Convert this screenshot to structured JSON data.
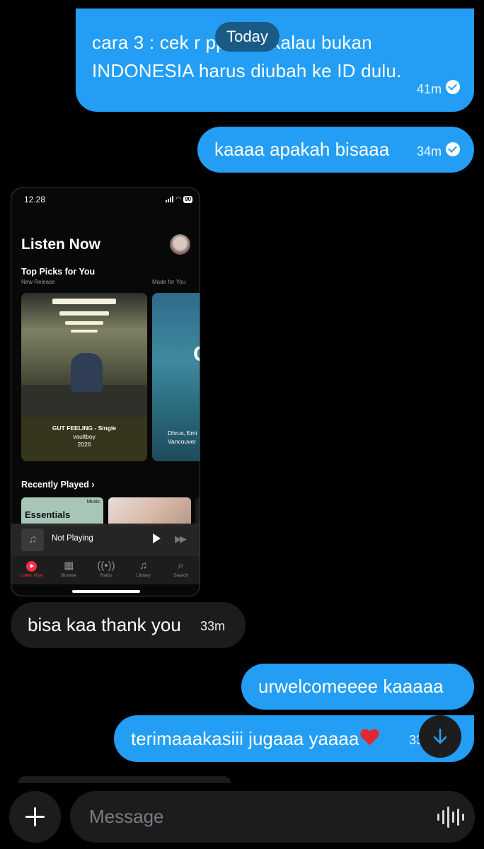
{
  "chat": {
    "date_separator": "Today",
    "messages": [
      {
        "id": "b1",
        "dir": "out",
        "lines": [
          "cara 3 : cek r      pple id, kalau bukan",
          "INDONESIA harus diubah ke ID dulu."
        ],
        "time": "41m",
        "read": true
      },
      {
        "id": "b2",
        "dir": "out",
        "text": "kaaaa apakah bisaaa",
        "time": "34m",
        "read": true
      },
      {
        "id": "b3",
        "dir": "in",
        "text": "bisa kaa thank you",
        "time": "33m"
      },
      {
        "id": "b4",
        "dir": "out",
        "text": "urwelcomeeee kaaaaa"
      },
      {
        "id": "b5",
        "dir": "out",
        "text": "terimaaakasiii jugaaa yaaaa",
        "time": "33"
      }
    ]
  },
  "screenshot": {
    "status_time": "12.28",
    "battery": "90",
    "title": "Listen Now",
    "section_title": "Top Picks for You",
    "sub_left": "New Release",
    "sub_right": "Made for You",
    "card1": {
      "title": "GUT FEELING - Single",
      "artist": "vaultboy",
      "year": "2026"
    },
    "card2": {
      "line1": "Dhruv, Emi",
      "line2": "Vancouver",
      "big_letter": "C"
    },
    "recently_played": "Recently Played",
    "tile1": {
      "title": "Essentials",
      "badge": "Music"
    },
    "mini_player": {
      "label": "Not Playing"
    },
    "tabs": [
      {
        "label": "Listen Now",
        "icon": "play-circle-icon",
        "active": true
      },
      {
        "label": "Browse",
        "icon": "grid-icon"
      },
      {
        "label": "Radio",
        "icon": "radio-icon"
      },
      {
        "label": "Library",
        "icon": "library-icon"
      },
      {
        "label": "Search",
        "icon": "search-icon"
      }
    ],
    "accent": "#fa2d48"
  },
  "composer": {
    "placeholder": "Message"
  },
  "colors": {
    "outgoing_bubble": "#239ef4",
    "incoming_bubble": "#1c1c1e",
    "background": "#000000"
  }
}
